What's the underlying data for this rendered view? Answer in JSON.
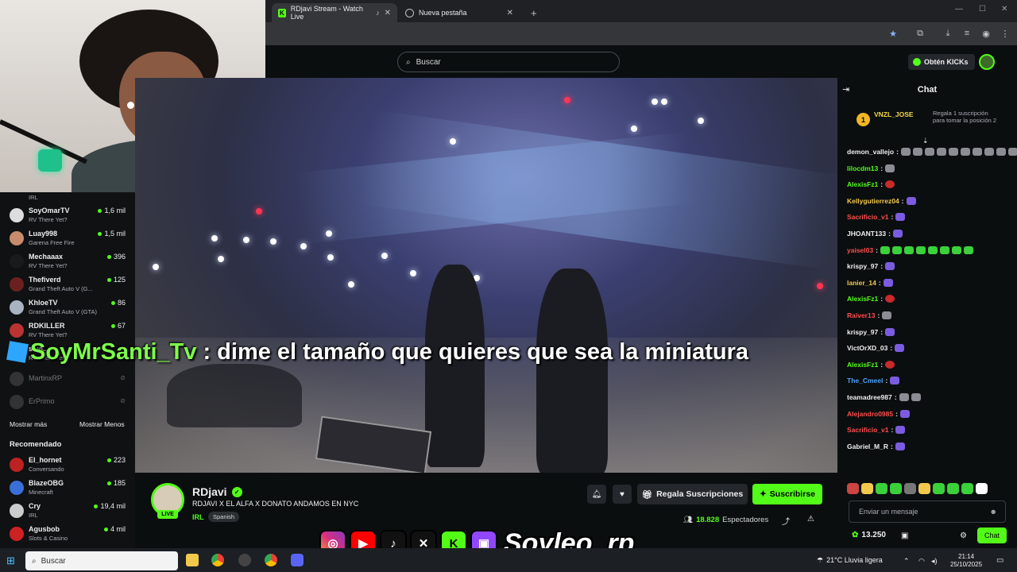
{
  "browser": {
    "tabs": [
      {
        "title": "RDjavi Stream - Watch Live",
        "active": true
      },
      {
        "title": "Nueva pestaña",
        "active": false
      }
    ]
  },
  "header": {
    "search_placeholder": "Buscar",
    "kicks_button": "Obtén KICKs"
  },
  "sidebar": {
    "top_category": "IRL",
    "following": [
      {
        "name": "SoyOmarTV",
        "category": "RV There Yet?",
        "viewers": "1,6 mil",
        "live": true
      },
      {
        "name": "Luay998",
        "category": "Garena Free Fire",
        "viewers": "1,5 mil",
        "live": true
      },
      {
        "name": "Mechaaax",
        "category": "RV There Yet?",
        "viewers": "396",
        "live": true
      },
      {
        "name": "Thefiverd",
        "category": "Grand Theft Auto V (G...",
        "viewers": "125",
        "live": true
      },
      {
        "name": "KhloeTV",
        "category": "Grand Theft Auto V (GTA)",
        "viewers": "86",
        "live": true
      },
      {
        "name": "RDKILLER",
        "category": "RV There Yet?",
        "viewers": "67",
        "live": true
      },
      {
        "name": "soyl...",
        "category": "RV There Yet",
        "viewers": "",
        "live": true
      },
      {
        "name": "MartinxRP",
        "category": "",
        "viewers": "",
        "live": false
      },
      {
        "name": "ErPrimo",
        "category": "",
        "viewers": "",
        "live": false
      }
    ],
    "show_more": "Mostrar más",
    "show_less": "Mostrar Menos",
    "recommended_title": "Recomendado",
    "recommended": [
      {
        "name": "El_hornet",
        "category": "Conversando",
        "viewers": "223"
      },
      {
        "name": "BlazeOBG",
        "category": "Minecraft",
        "viewers": "185"
      },
      {
        "name": "Cry",
        "category": "IRL",
        "viewers": "19,4 mil"
      },
      {
        "name": "Agusbob",
        "category": "Slots & Casino",
        "viewers": "4 mil"
      }
    ]
  },
  "overlay": {
    "user": "SoyMrSanti_Tv",
    "separator": ":",
    "message": "dime el tamaño que quieres que sea la miniatura"
  },
  "stream": {
    "streamer": "RDjavi",
    "live_badge": "LIVE",
    "title": "RDJAVI X EL ALFA X DONATO ANDAMOS EN NYC",
    "category": "IRL",
    "language": "Spanish",
    "gift_button": "Regala Suscripciones",
    "subscribe_button": "Suscribirse",
    "viewers": "18.828",
    "viewers_label": "Espectadores"
  },
  "socials": {
    "handle": "Soyleo_rp",
    "icons": [
      "instagram-icon",
      "youtube-icon",
      "tiktok-icon",
      "x-icon",
      "kick-icon",
      "twitch-icon"
    ]
  },
  "chat": {
    "title": "Chat",
    "pinned_rank": "1",
    "pinned_user": "VNZL_JOSE",
    "pinned_gift_text": "Regala 1 suscripción para tomar la posición 2",
    "messages": [
      {
        "user": "demon_vallejo",
        "color": "#efeff1",
        "emotes": 10,
        "emote_color": "gray"
      },
      {
        "user": "lilocdm13",
        "color": "#53fc18",
        "emotes": 1,
        "emote_color": "gray"
      },
      {
        "user": "AlexisFz1",
        "color": "#53fc18",
        "emotes": 1,
        "emote_color": "red"
      },
      {
        "user": "Kellygutierrez04",
        "color": "#f2c94c",
        "emotes": 1,
        "emote_color": "purple"
      },
      {
        "user": "Sacrificio_v1",
        "color": "#ff4d4d",
        "emotes": 1,
        "emote_color": "purple"
      },
      {
        "user": "JHOANT133",
        "color": "#efeff1",
        "emotes": 1,
        "emote_color": "purple"
      },
      {
        "user": "yaisel03",
        "color": "#ff4d4d",
        "emotes": 8,
        "emote_color": "green"
      },
      {
        "user": "krispy_97",
        "color": "#efeff1",
        "emotes": 1,
        "emote_color": "purple"
      },
      {
        "user": "lanier_14",
        "color": "#f2c94c",
        "emotes": 1,
        "emote_color": "purple"
      },
      {
        "user": "AlexisFz1",
        "color": "#53fc18",
        "emotes": 1,
        "emote_color": "red"
      },
      {
        "user": "Raiver13",
        "color": "#ff4d4d",
        "emotes": 1,
        "emote_color": "gray"
      },
      {
        "user": "krispy_97",
        "color": "#efeff1",
        "emotes": 1,
        "emote_color": "purple"
      },
      {
        "user": "VictOrXD_03",
        "color": "#efeff1",
        "emotes": 1,
        "emote_color": "purple"
      },
      {
        "user": "AlexisFz1",
        "color": "#53fc18",
        "emotes": 1,
        "emote_color": "red"
      },
      {
        "user": "The_Cmeel",
        "color": "#4aa3ff",
        "emotes": 1,
        "emote_color": "purple"
      },
      {
        "user": "teamadree987",
        "color": "#efeff1",
        "emotes": 2,
        "emote_color": "gray"
      },
      {
        "user": "Alejandro0985",
        "color": "#ff4d4d",
        "emotes": 1,
        "emote_color": "purple"
      },
      {
        "user": "Sacrificio_v1",
        "color": "#ff4d4d",
        "emotes": 1,
        "emote_color": "purple"
      },
      {
        "user": "Gabriel_M_R",
        "color": "#efeff1",
        "emotes": 1,
        "emote_color": "purple"
      }
    ],
    "input_placeholder": "Enviar un mensaje",
    "kicks_balance": "13.250",
    "send_button": "Chat"
  },
  "taskbar": {
    "search_placeholder": "Buscar",
    "weather": "21°C  Lluvia ligera",
    "time": "21:14",
    "date": "25/10/2025"
  }
}
